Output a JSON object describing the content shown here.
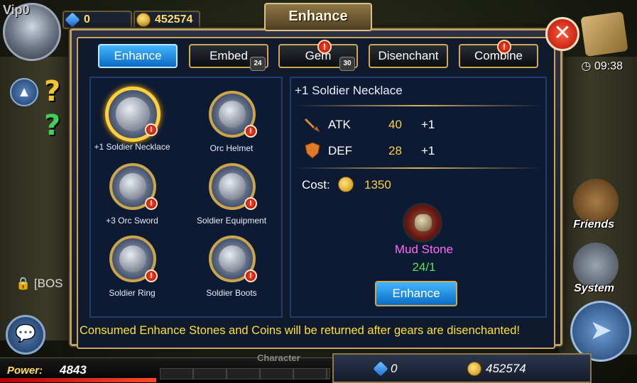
{
  "hud": {
    "vip": "Vip0",
    "gems": "0",
    "coins": "452574",
    "clock": "09:38",
    "boss_label": "[BOS",
    "friends": "Friends",
    "system": "System",
    "power_label": "Power:",
    "power_value": "4843",
    "character_label": "Character",
    "bottom_gems": "0",
    "bottom_coins": "452574"
  },
  "modal": {
    "title": "Enhance",
    "close_symbol": "✕",
    "tabs": [
      {
        "label": "Enhance",
        "active": true
      },
      {
        "label": "Embed",
        "lock_level": "24"
      },
      {
        "label": "Gem",
        "lock_level": "30",
        "alert": "!"
      },
      {
        "label": "Disenchant"
      },
      {
        "label": "Combine",
        "alert": "!"
      }
    ],
    "items": [
      {
        "name": "+1 Soldier Necklace",
        "icon": "necklace-icon",
        "selected": true,
        "alert": "!"
      },
      {
        "name": "Orc Helmet",
        "icon": "helmet-icon",
        "alert": "!"
      },
      {
        "name": "+3 Orc Sword",
        "icon": "sword-icon",
        "alert": "!"
      },
      {
        "name": "Soldier Equipment",
        "icon": "armor-icon",
        "alert": "!"
      },
      {
        "name": "Soldier Ring",
        "icon": "ring-icon",
        "alert": "!"
      },
      {
        "name": "Soldier Boots",
        "icon": "boots-icon",
        "alert": "!"
      }
    ],
    "detail": {
      "title": "+1 Soldier Necklace",
      "stats": [
        {
          "name": "ATK",
          "value": "40",
          "bonus": "+1",
          "icon": "sword-stat-icon"
        },
        {
          "name": "DEF",
          "value": "28",
          "bonus": "+1",
          "icon": "shield-stat-icon"
        }
      ],
      "cost_label": "Cost:",
      "cost_value": "1350",
      "material_name": "Mud Stone",
      "material_count": "24/1",
      "enhance_button": "Enhance"
    },
    "footer_note": "Consumed Enhance Stones and Coins will be returned after gears are disenchanted!"
  },
  "colors": {
    "accent_gold": "#cfa850",
    "active_tab": "#1a8ee6",
    "stat_value": "#ffcf3e",
    "material_name": "#ff6df0",
    "material_count": "#57e35a",
    "footer_note": "#ffe033"
  }
}
